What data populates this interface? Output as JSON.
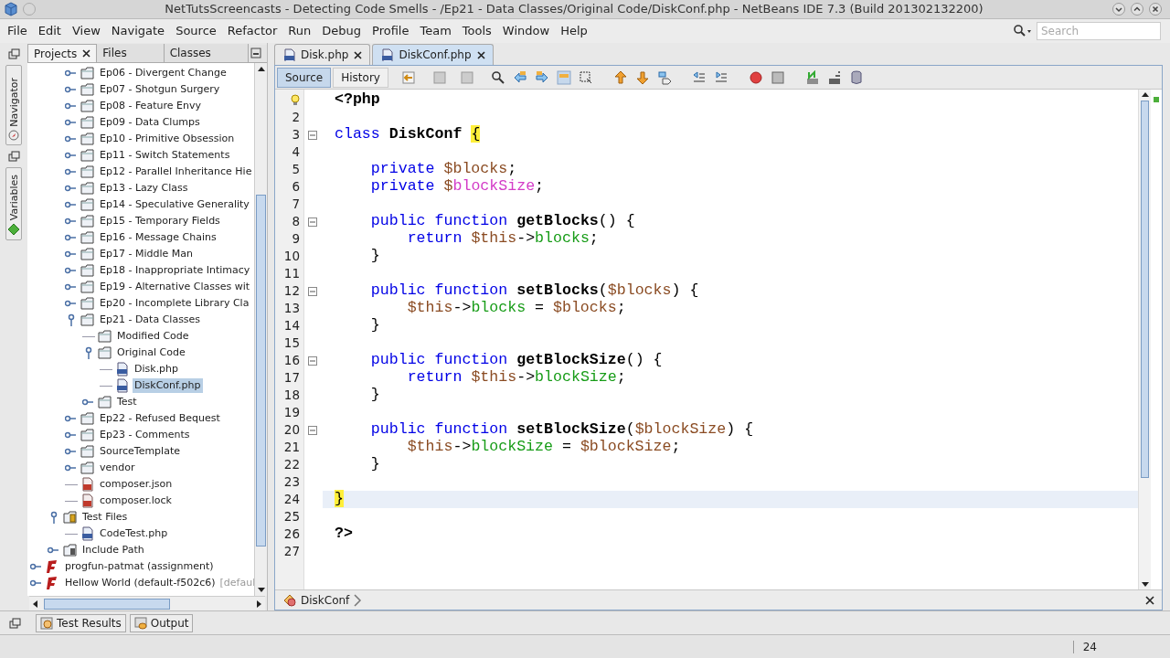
{
  "window": {
    "title": "NetTutsScreencasts - Detecting Code Smells - /Ep21 - Data Classes/Original Code/DiskConf.php - NetBeans IDE 7.3 (Build 201302132200)"
  },
  "menu": [
    "File",
    "Edit",
    "View",
    "Navigate",
    "Source",
    "Refactor",
    "Run",
    "Debug",
    "Profile",
    "Team",
    "Tools",
    "Window",
    "Help"
  ],
  "search": {
    "placeholder": "Search"
  },
  "side_strip": [
    "Navigator",
    "Variables"
  ],
  "project_tabs": [
    {
      "label": "Projects",
      "selected": true,
      "closable": true
    },
    {
      "label": "Files",
      "selected": false,
      "closable": false
    },
    {
      "label": "Classes",
      "selected": false,
      "closable": false
    }
  ],
  "tree": [
    {
      "children": [
        {
          "children": [
            {
              "label": "Ep06 - Divergent Change",
              "kind": "folder",
              "expanded": false,
              "selected": false
            },
            {
              "label": "Ep07 - Shotgun Surgery",
              "kind": "folder",
              "expanded": false,
              "selected": false
            },
            {
              "label": "Ep08 - Feature Envy",
              "kind": "folder",
              "expanded": false,
              "selected": false
            },
            {
              "label": "Ep09 - Data Clumps",
              "kind": "folder",
              "expanded": false,
              "selected": false
            },
            {
              "label": "Ep10 - Primitive Obsession",
              "kind": "folder",
              "expanded": false,
              "selected": false
            },
            {
              "label": "Ep11 - Switch Statements",
              "kind": "folder",
              "expanded": false,
              "selected": false
            },
            {
              "label": "Ep12 - Parallel Inheritance Hie",
              "kind": "folder",
              "expanded": false,
              "selected": false
            },
            {
              "label": "Ep13 - Lazy Class",
              "kind": "folder",
              "expanded": false,
              "selected": false
            },
            {
              "label": "Ep14 - Speculative Generality",
              "kind": "folder",
              "expanded": false,
              "selected": false
            },
            {
              "label": "Ep15 - Temporary Fields",
              "kind": "folder",
              "expanded": false,
              "selected": false
            },
            {
              "label": "Ep16 - Message Chains",
              "kind": "folder",
              "expanded": false,
              "selected": false
            },
            {
              "label": "Ep17 - Middle Man",
              "kind": "folder",
              "expanded": false,
              "selected": false
            },
            {
              "label": "Ep18 - Inappropriate Intimacy",
              "kind": "folder",
              "expanded": false,
              "selected": false
            },
            {
              "label": "Ep19 - Alternative Classes wit",
              "kind": "folder",
              "expanded": false,
              "selected": false
            },
            {
              "label": "Ep20 - Incomplete Library Cla",
              "kind": "folder",
              "expanded": false,
              "selected": false
            },
            {
              "label": "Ep21 - Data Classes",
              "kind": "folder",
              "expanded": true,
              "selected": false,
              "children": [
                {
                  "label": "Modified Code",
                  "kind": "folder",
                  "selected": false
                },
                {
                  "label": "Original Code",
                  "kind": "folder",
                  "expanded": true,
                  "selected": false,
                  "children": [
                    {
                      "label": "Disk.php",
                      "kind": "php",
                      "selected": false
                    },
                    {
                      "label": "DiskConf.php",
                      "kind": "php",
                      "selected": true
                    }
                  ]
                },
                {
                  "label": "Test",
                  "kind": "folder",
                  "expanded": false,
                  "selected": false
                }
              ]
            },
            {
              "label": "Ep22 - Refused Bequest",
              "kind": "folder",
              "expanded": false,
              "selected": false
            },
            {
              "label": "Ep23 - Comments",
              "kind": "folder",
              "expanded": false,
              "selected": false
            },
            {
              "label": "SourceTemplate",
              "kind": "folder",
              "expanded": false,
              "selected": false
            },
            {
              "label": "vendor",
              "kind": "folder",
              "expanded": false,
              "selected": false
            },
            {
              "label": "composer.json",
              "kind": "js",
              "selected": false
            },
            {
              "label": "composer.lock",
              "kind": "js",
              "selected": false
            }
          ]
        },
        {
          "label": "Test Files",
          "kind": "testfolder",
          "expanded": true,
          "selected": false,
          "children": [
            {
              "label": "CodeTest.php",
              "kind": "php",
              "selected": false
            }
          ]
        },
        {
          "label": "Include Path",
          "kind": "library",
          "expanded": false,
          "selected": false
        }
      ]
    },
    {
      "label": "progfun-patmat (assignment)",
      "kind": "project",
      "expanded": false,
      "selected": false
    },
    {
      "label": "Hellow World (default-f502c6)",
      "note": "[defaul",
      "kind": "project",
      "expanded": false,
      "selected": false
    }
  ],
  "editor_tabs": [
    {
      "label": "Disk.php",
      "selected": false
    },
    {
      "label": "DiskConf.php",
      "selected": true
    }
  ],
  "view_buttons": [
    {
      "label": "Source",
      "selected": true
    },
    {
      "label": "History",
      "selected": false
    }
  ],
  "code": [
    {
      "current": false,
      "hint": true,
      "fold": false,
      "tokens": [
        {
          "t": "<?php",
          "kind": "tag"
        }
      ]
    },
    {
      "n": "2",
      "current": false,
      "hint": false,
      "fold": false
    },
    {
      "n": "3",
      "current": false,
      "hint": false,
      "fold": true,
      "tokens": [
        {
          "t": "class ",
          "kind": "kw"
        },
        {
          "t": "DiskConf ",
          "kind": "name"
        },
        {
          "t": "{",
          "kind": "match"
        }
      ]
    },
    {
      "n": "4",
      "current": false,
      "hint": false,
      "fold": false
    },
    {
      "n": "5",
      "current": false,
      "hint": false,
      "fold": false,
      "tokens": [
        {
          "t": "    private ",
          "kind": "kw"
        },
        {
          "t": "$blocks",
          "kind": "var"
        },
        {
          "t": ";",
          "kind": "plain"
        }
      ]
    },
    {
      "n": "6",
      "current": false,
      "hint": false,
      "fold": false,
      "tokens": [
        {
          "t": "    private ",
          "kind": "kw"
        },
        {
          "t": "$",
          "kind": "var"
        },
        {
          "t": "blockSize",
          "kind": "unused"
        },
        {
          "t": ";",
          "kind": "plain"
        }
      ]
    },
    {
      "n": "7",
      "current": false,
      "hint": false,
      "fold": false
    },
    {
      "n": "8",
      "current": false,
      "hint": false,
      "fold": true,
      "tokens": [
        {
          "t": "    public function ",
          "kind": "kw"
        },
        {
          "t": "getBlocks",
          "kind": "name"
        },
        {
          "t": "() {",
          "kind": "plain"
        }
      ]
    },
    {
      "n": "9",
      "current": false,
      "hint": false,
      "fold": false,
      "tokens": [
        {
          "t": "        return ",
          "kind": "kw"
        },
        {
          "t": "$this",
          "kind": "var"
        },
        {
          "t": "->",
          "kind": "plain"
        },
        {
          "t": "blocks",
          "kind": "field"
        },
        {
          "t": ";",
          "kind": "plain"
        }
      ]
    },
    {
      "n": "10",
      "current": false,
      "hint": false,
      "fold": false,
      "tokens": [
        {
          "t": "    }",
          "kind": "plain"
        }
      ]
    },
    {
      "n": "11",
      "current": false,
      "hint": false,
      "fold": false
    },
    {
      "n": "12",
      "current": false,
      "hint": false,
      "fold": true,
      "tokens": [
        {
          "t": "    public function ",
          "kind": "kw"
        },
        {
          "t": "setBlocks",
          "kind": "name"
        },
        {
          "t": "(",
          "kind": "plain"
        },
        {
          "t": "$blocks",
          "kind": "var"
        },
        {
          "t": ") {",
          "kind": "plain"
        }
      ]
    },
    {
      "n": "13",
      "current": false,
      "hint": false,
      "fold": false,
      "tokens": [
        {
          "t": "        $this",
          "kind": "var"
        },
        {
          "t": "->",
          "kind": "plain"
        },
        {
          "t": "blocks",
          "kind": "field"
        },
        {
          "t": " = ",
          "kind": "plain"
        },
        {
          "t": "$blocks",
          "kind": "var"
        },
        {
          "t": ";",
          "kind": "plain"
        }
      ]
    },
    {
      "n": "14",
      "current": false,
      "hint": false,
      "fold": false,
      "tokens": [
        {
          "t": "    }",
          "kind": "plain"
        }
      ]
    },
    {
      "n": "15",
      "current": false,
      "hint": false,
      "fold": false
    },
    {
      "n": "16",
      "current": false,
      "hint": false,
      "fold": true,
      "tokens": [
        {
          "t": "    public function ",
          "kind": "kw"
        },
        {
          "t": "getBlockSize",
          "kind": "name"
        },
        {
          "t": "() {",
          "kind": "plain"
        }
      ]
    },
    {
      "n": "17",
      "current": false,
      "hint": false,
      "fold": false,
      "tokens": [
        {
          "t": "        return ",
          "kind": "kw"
        },
        {
          "t": "$this",
          "kind": "var"
        },
        {
          "t": "->",
          "kind": "plain"
        },
        {
          "t": "blockSize",
          "kind": "field"
        },
        {
          "t": ";",
          "kind": "plain"
        }
      ]
    },
    {
      "n": "18",
      "current": false,
      "hint": false,
      "fold": false,
      "tokens": [
        {
          "t": "    }",
          "kind": "plain"
        }
      ]
    },
    {
      "n": "19",
      "current": false,
      "hint": false,
      "fold": false
    },
    {
      "n": "20",
      "current": false,
      "hint": false,
      "fold": true,
      "tokens": [
        {
          "t": "    public function ",
          "kind": "kw"
        },
        {
          "t": "setBlockSize",
          "kind": "name"
        },
        {
          "t": "(",
          "kind": "plain"
        },
        {
          "t": "$blockSize",
          "kind": "var"
        },
        {
          "t": ") {",
          "kind": "plain"
        }
      ]
    },
    {
      "n": "21",
      "current": false,
      "hint": false,
      "fold": false,
      "tokens": [
        {
          "t": "        $this",
          "kind": "var"
        },
        {
          "t": "->",
          "kind": "plain"
        },
        {
          "t": "blockSize",
          "kind": "field"
        },
        {
          "t": " = ",
          "kind": "plain"
        },
        {
          "t": "$blockSize",
          "kind": "var"
        },
        {
          "t": ";",
          "kind": "plain"
        }
      ]
    },
    {
      "n": "22",
      "current": false,
      "hint": false,
      "fold": false,
      "tokens": [
        {
          "t": "    }",
          "kind": "plain"
        }
      ]
    },
    {
      "n": "23",
      "current": false,
      "hint": false,
      "fold": false
    },
    {
      "n": "24",
      "current": true,
      "hint": false,
      "fold": false,
      "tokens": [
        {
          "t": "}",
          "kind": "match"
        }
      ]
    },
    {
      "n": "25",
      "current": false,
      "hint": false,
      "fold": false
    },
    {
      "n": "26",
      "current": false,
      "hint": false,
      "fold": false,
      "tokens": [
        {
          "t": "?>",
          "kind": "tag"
        }
      ]
    },
    {
      "n": "27",
      "current": false,
      "hint": false,
      "fold": false
    }
  ],
  "breadcrumb": "DiskConf",
  "bottom_tabs": [
    "Test Results",
    "Output"
  ],
  "status_bar": {
    "line": "24"
  }
}
